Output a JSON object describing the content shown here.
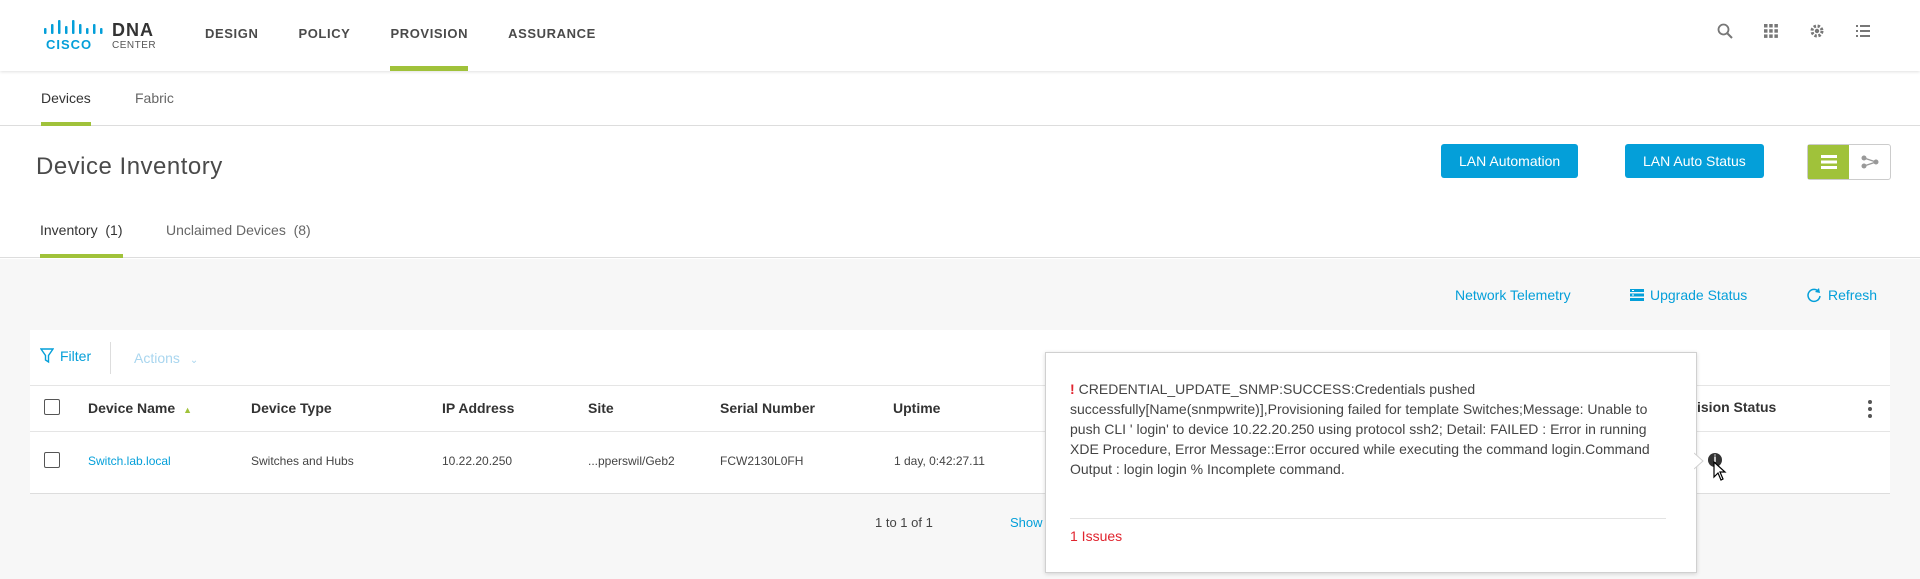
{
  "brand": {
    "logo_text": "cisco",
    "product": "DNA",
    "product_sub": "CENTER"
  },
  "nav": {
    "items": [
      "DESIGN",
      "POLICY",
      "PROVISION",
      "ASSURANCE"
    ],
    "active": "PROVISION"
  },
  "top_icons": [
    "search-icon",
    "apps-grid-icon",
    "gear-icon",
    "list-icon"
  ],
  "subtabs": {
    "devices": "Devices",
    "fabric": "Fabric"
  },
  "page": {
    "title": "Device Inventory",
    "lan_automation": "LAN Automation",
    "lan_auto_status": "LAN Auto Status"
  },
  "inventory_tabs": {
    "inventory": "Inventory",
    "inventory_count": "(1)",
    "unclaimed": "Unclaimed Devices",
    "unclaimed_count": "(8)"
  },
  "toolbar": {
    "network_telemetry": "Network Telemetry",
    "upgrade_status": "Upgrade Status",
    "refresh": "Refresh",
    "filter": "Filter",
    "actions": "Actions"
  },
  "table": {
    "columns": {
      "device_name": "Device Name",
      "device_type": "Device Type",
      "ip_address": "IP Address",
      "site": "Site",
      "serial_number": "Serial Number",
      "uptime": "Uptime",
      "provision_status": "ision Status"
    },
    "rows": [
      {
        "device_name": "Switch.lab.local",
        "device_type": "Switches and Hubs",
        "ip_address": "10.22.20.250",
        "site": "...pperswil/Geb2",
        "serial_number": "FCW2130L0FH",
        "uptime": "1 day, 0:42:27.11"
      }
    ]
  },
  "pager": {
    "range": "1 to 1 of 1",
    "show": "Show"
  },
  "popover": {
    "message": "CREDENTIAL_UPDATE_SNMP:SUCCESS:Credentials pushed successfully[Name(snmpwrite)],Provisioning failed for template Switches;Message: Unable to push CLI ' login' to device 10.22.20.250 using protocol ssh2; Detail: FAILED : Error in running XDE Procedure, Error Message::Error occured while executing the command login.Command Output : login login % Incomplete command.",
    "issues": "1 Issues"
  },
  "colors": {
    "accent": "#a0c23a",
    "link": "#049fd9",
    "error": "#e0242e"
  }
}
